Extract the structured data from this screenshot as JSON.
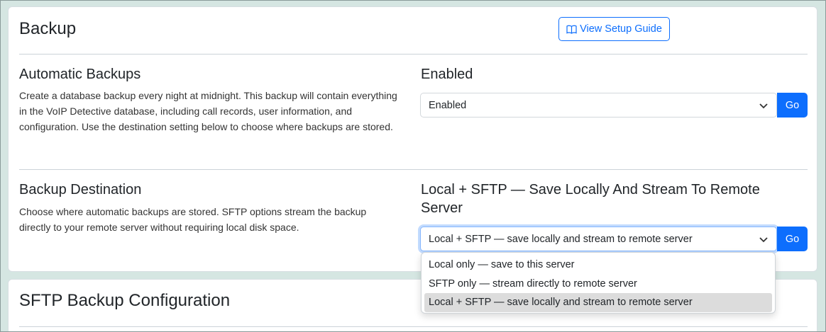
{
  "backup": {
    "title": "Backup",
    "setup_guide_label": "View Setup Guide"
  },
  "automatic_backups": {
    "title": "Automatic Backups",
    "description": "Create a database backup every night at midnight. This backup will contain everything in the VoIP Detective database, including call records, user information, and configuration. Use the destination setting below to choose where backups are stored.",
    "current_value": "Enabled",
    "select_value": "Enabled",
    "go_label": "Go"
  },
  "backup_destination": {
    "title": "Backup Destination",
    "description": "Choose where automatic backups are stored. SFTP options stream the backup directly to your remote server without requiring local disk space.",
    "current_value": "Local + SFTP — Save Locally And Stream To Remote Server",
    "select_value": "Local + SFTP — save locally and stream to remote server",
    "go_label": "Go",
    "options": [
      "Local only — save to this server",
      "SFTP only — stream directly to remote server",
      "Local + SFTP — save locally and stream to remote server"
    ]
  },
  "sftp": {
    "title": "SFTP Backup Configuration"
  },
  "colors": {
    "accent": "#0d6efd",
    "background": "#d5e6e2"
  },
  "icons": {
    "guide": "book-icon",
    "select": "chevron-down-icon"
  }
}
